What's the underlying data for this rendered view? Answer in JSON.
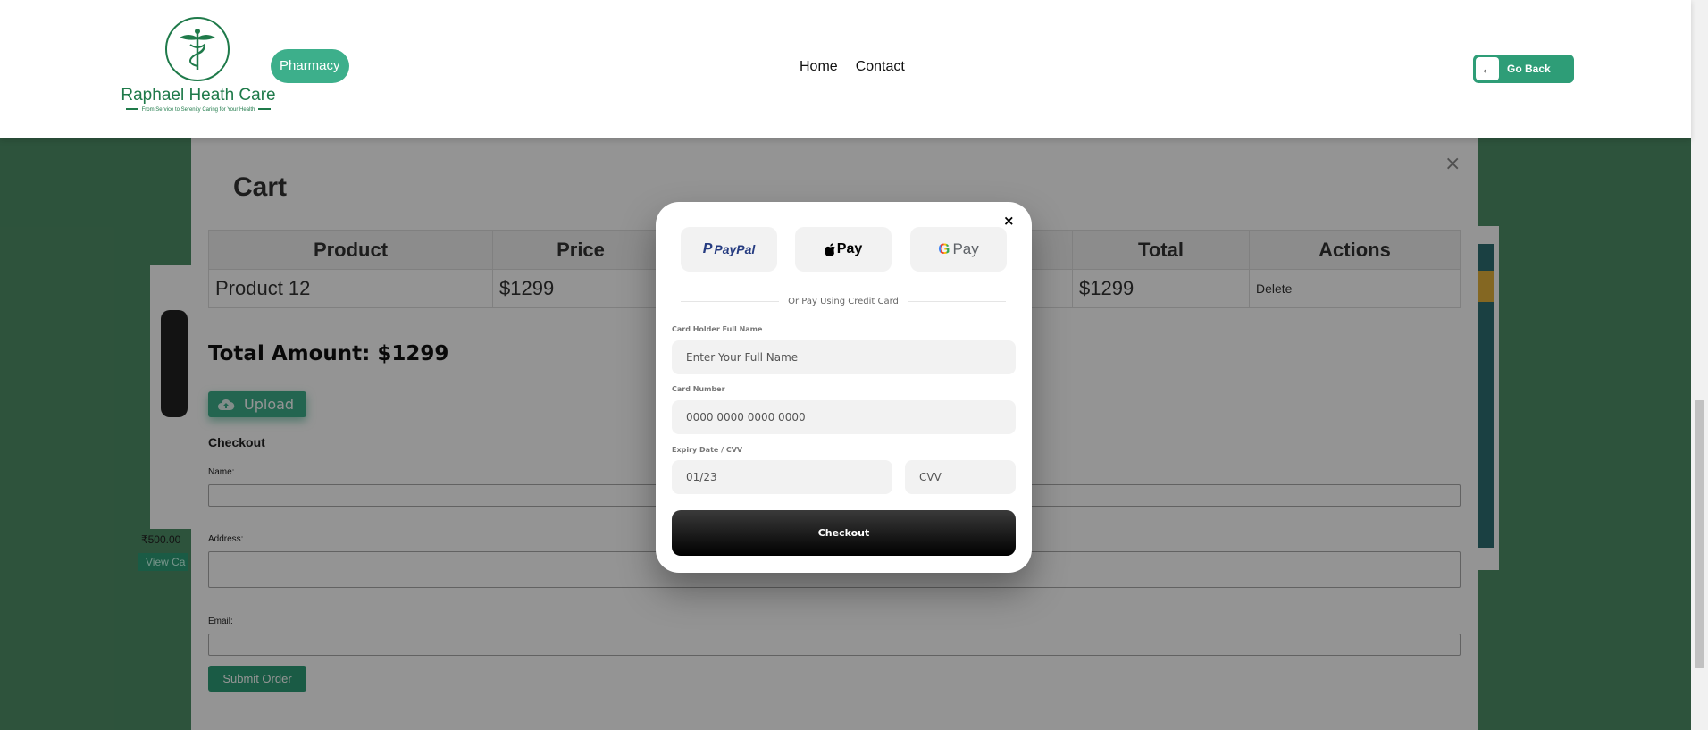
{
  "header": {
    "brand_name": "Raphael Heath Care",
    "brand_tagline": "From Service to Serenity Caring for Your Health",
    "pharmacy_label": "Pharmacy",
    "nav": [
      {
        "label": "Home"
      },
      {
        "label": "Contact"
      }
    ],
    "go_back_icon": "←",
    "go_back_label": "Go Back"
  },
  "background_page": {
    "price_left": "₹500.00",
    "view_cart_label": "View Ca"
  },
  "cart": {
    "title": "Cart",
    "close_icon": "×",
    "columns": [
      "Product",
      "Price",
      "",
      "Total",
      "Actions"
    ],
    "rows": [
      {
        "product": "Product 12",
        "price": "$1299",
        "quantity": "",
        "total": "$1299",
        "action": "Delete"
      }
    ],
    "total_amount": "Total Amount: $1299",
    "upload_label": "Upload",
    "checkout_heading": "Checkout",
    "name_label": "Name:",
    "address_label": "Address:",
    "email_label": "Email:",
    "submit_label": "Submit Order"
  },
  "payment_modal": {
    "close_icon": "×",
    "wallets": {
      "paypal": "PayPal",
      "apple_pay": "Pay",
      "google_pay": "Pay"
    },
    "divider_text": "Or Pay Using Credit Card",
    "card_holder_label": "Card Holder Full Name",
    "card_holder_placeholder": "Enter Your Full Name",
    "card_number_label": "Card Number",
    "card_number_placeholder": "0000 0000 0000 0000",
    "expiry_cvv_label": "Expiry Date / CVV",
    "expiry_placeholder": "01/23",
    "cvv_placeholder": "CVV",
    "checkout_label": "Checkout"
  },
  "colors": {
    "brand_green": "#1f7a4a",
    "accent_green": "#3daf8b",
    "page_bg": "#4f8f68"
  }
}
